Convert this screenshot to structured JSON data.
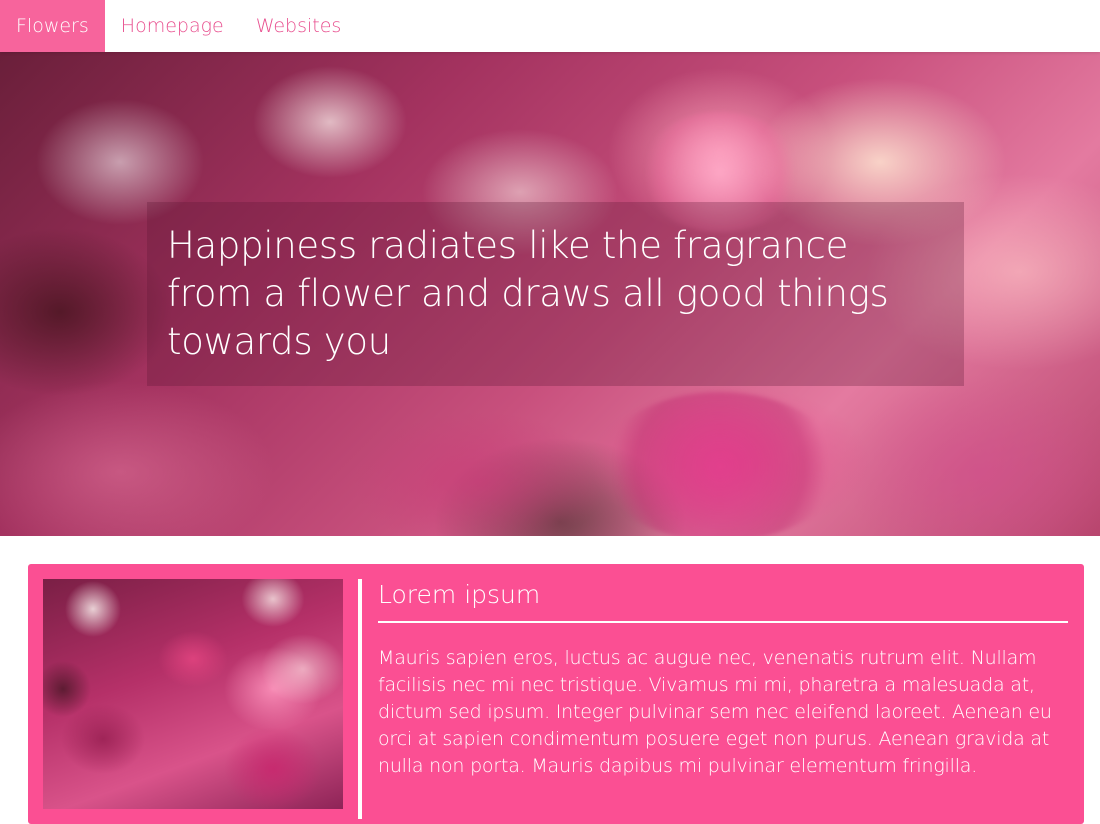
{
  "nav": {
    "items": [
      {
        "label": "Flowers",
        "active": true
      },
      {
        "label": "Homepage",
        "active": false
      },
      {
        "label": "Websites",
        "active": false
      }
    ]
  },
  "hero": {
    "quote": "Happiness radiates like the fragrance from a flower and draws all good things towards you"
  },
  "card": {
    "title": "Lorem ipsum",
    "text": "Mauris sapien eros, luctus ac augue nec, venenatis rutrum elit. Nullam facilisis nec mi nec tristique. Vivamus mi mi, pharetra a malesuada at, dictum sed ipsum. Integer pulvinar sem nec eleifend laoreet. Aenean eu orci at sapien condimentum posuere eget non purus. Aenean gravida at nulla non porta. Mauris dapibus mi pulvinar elementum fringilla."
  },
  "colors": {
    "accent": "#fb4f93",
    "nav_active_bg": "#f7649c",
    "nav_text": "#e8508f"
  }
}
